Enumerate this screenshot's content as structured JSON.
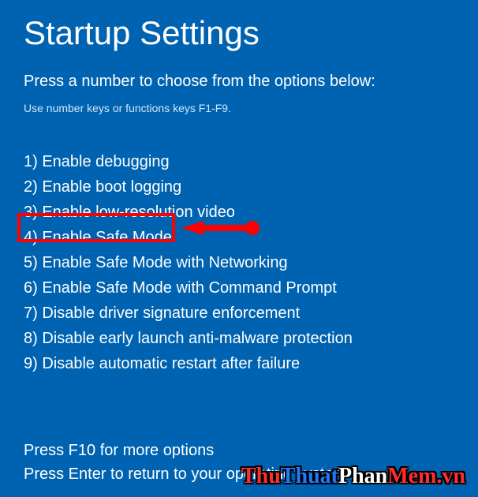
{
  "title": "Startup Settings",
  "prompt": "Press a number to choose from the options below:",
  "hint": "Use number keys or functions keys F1-F9.",
  "options": [
    {
      "n": "1",
      "label": "Enable debugging"
    },
    {
      "n": "2",
      "label": "Enable boot logging"
    },
    {
      "n": "3",
      "label": "Enable low-resolution video"
    },
    {
      "n": "4",
      "label": "Enable Safe Mode"
    },
    {
      "n": "5",
      "label": "Enable Safe Mode with Networking"
    },
    {
      "n": "6",
      "label": "Enable Safe Mode with Command Prompt"
    },
    {
      "n": "7",
      "label": "Disable driver signature enforcement"
    },
    {
      "n": "8",
      "label": "Disable early launch anti-malware protection"
    },
    {
      "n": "9",
      "label": "Disable automatic restart after failure"
    }
  ],
  "footer": {
    "more": "Press F10 for more options",
    "back": "Press Enter to return to your operating system"
  },
  "highlighted_option_index": 3,
  "colors": {
    "background": "#0063b1",
    "text": "#ffffff",
    "highlight_border": "#ff0000"
  },
  "watermark": {
    "seg1": "Thu",
    "seg2": "Thuat",
    "seg3": "Phan",
    "seg4": "Mem.vn"
  }
}
